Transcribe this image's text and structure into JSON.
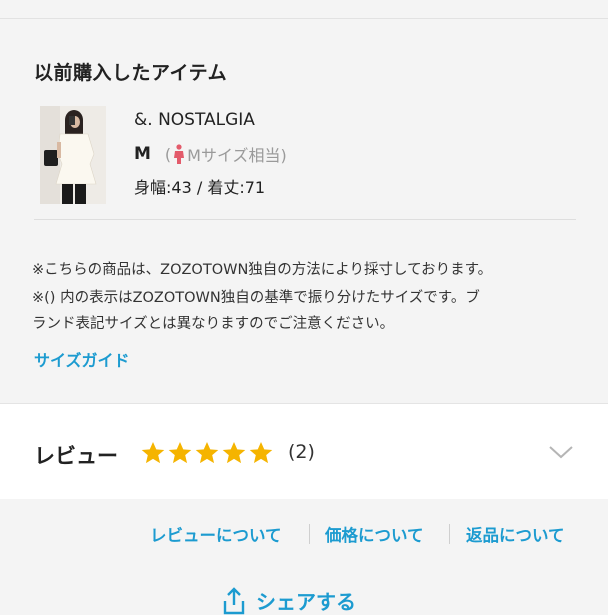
{
  "purchased": {
    "title": "以前購入したアイテム",
    "brand": "&. NOSTALGIA",
    "size": "M",
    "size_note": "Mサイズ相当)",
    "size_note_open": "(",
    "measurements": "身幅:43 / 着丈:71"
  },
  "notes": {
    "line1": "※こちらの商品は、ZOZOTOWN独自の方法により採寸しております。",
    "line2": "※() 内の表示はZOZOTOWN独自の基準で振り分けたサイズです。ブ",
    "line3": "ランド表記サイズとは異なりますのでご注意ください。"
  },
  "size_guide": "サイズガイド",
  "review": {
    "label": "レビュー",
    "rating": 5,
    "count": "(2)"
  },
  "footer_links": {
    "review_about": "レビューについて",
    "price_about": "価格について",
    "return_about": "返品について"
  },
  "share": "シェアする",
  "colors": {
    "accent": "#1c9bd0",
    "star": "#f5b400",
    "person_icon": "#e35b6b"
  }
}
